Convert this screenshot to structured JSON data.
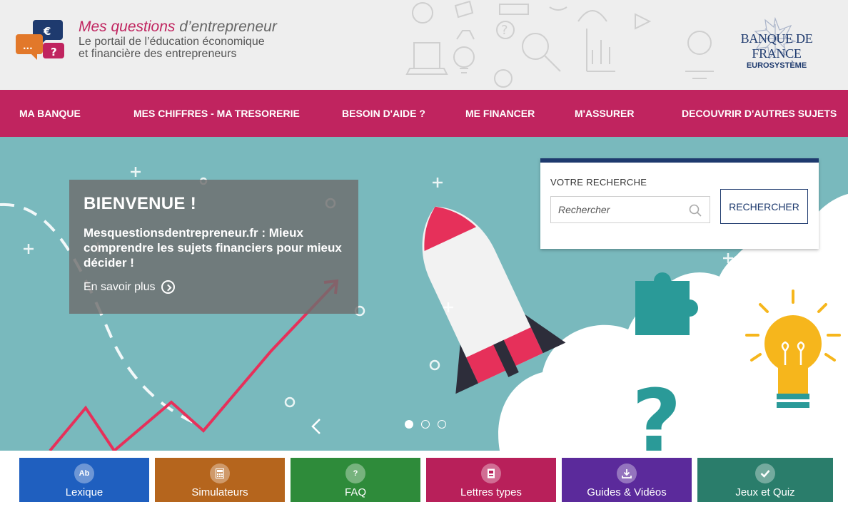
{
  "header": {
    "logo_title_accent": "Mes questions",
    "logo_title_rest": " d’entrepreneur",
    "logo_sub_1": "Le portail de l’éducation économique",
    "logo_sub_2": "et financière des entrepreneurs",
    "bank_name": "BANQUE DE FRANCE",
    "bank_sub": "EUROSYSTÈME"
  },
  "nav": {
    "items": [
      {
        "label": "MA BANQUE"
      },
      {
        "label": "MES CHIFFRES - MA TRESORERIE"
      },
      {
        "label": "BESOIN D'AIDE ?"
      },
      {
        "label": "ME FINANCER"
      },
      {
        "label": "M'ASSURER"
      },
      {
        "label": "DECOUVRIR D'AUTRES SUJETS"
      }
    ]
  },
  "hero": {
    "title": "BIENVENUE !",
    "text": "Mesquestionsdentrepreneur.fr : Mieux comprendre les sujets financiers pour mieux décider !",
    "link": "En savoir plus"
  },
  "search": {
    "label": "VOTRE RECHERCHE",
    "placeholder": "Rechercher",
    "button": "RECHERCHER"
  },
  "carousel": {
    "slides": 3,
    "active": 1
  },
  "tiles": [
    {
      "label": "Lexique",
      "icon": "Ab",
      "color": "#1f5fbf"
    },
    {
      "label": "Simulateurs",
      "icon": "calculator-icon",
      "color": "#b5651d"
    },
    {
      "label": "FAQ",
      "icon": "?",
      "color": "#2e8b3a"
    },
    {
      "label": "Lettres types",
      "icon": "document-icon",
      "color": "#b8205a"
    },
    {
      "label": "Guides & Vidéos",
      "icon": "download-icon",
      "color": "#5b2a9b"
    },
    {
      "label": "Jeux et Quiz",
      "icon": "check-icon",
      "color": "#2a7d6b"
    }
  ],
  "colors": {
    "brand": "#c0245f",
    "navy": "#1e3a6e",
    "hero_bg": "#79b9bd"
  }
}
